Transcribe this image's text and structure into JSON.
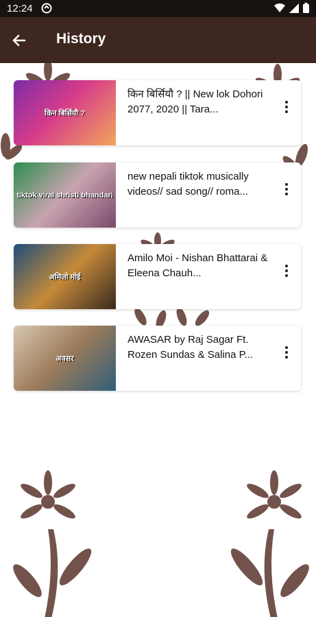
{
  "status": {
    "time": "12:24"
  },
  "header": {
    "title": "History"
  },
  "videos": [
    {
      "title": "किन बिर्सियौ ? || New lok Dohori 2077, 2020 || Tara...",
      "thumb_text": "किन बिर्सियौ ?"
    },
    {
      "title": "new nepali tiktok musically videos// sad song// roma...",
      "thumb_text": "tiktok viral shristi bhandari"
    },
    {
      "title": "Amilo Moi - Nishan Bhattarai & Eleena Chauh...",
      "thumb_text": "अमिलो मोई"
    },
    {
      "title": "AWASAR by Raj Sagar Ft. Rozen Sundas & Salina P...",
      "thumb_text": "अवसर"
    }
  ],
  "colors": {
    "app_bar": "#3e2720",
    "status_bar": "#181210",
    "decoration": "#6b4a43"
  }
}
